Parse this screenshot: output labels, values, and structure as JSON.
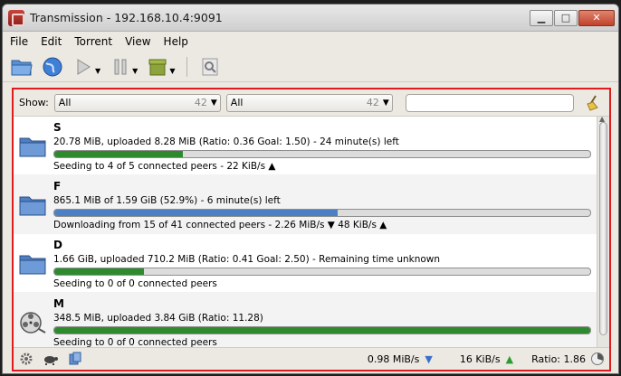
{
  "window": {
    "title": "Transmission - 192.168.10.4:9091"
  },
  "menu": [
    "File",
    "Edit",
    "Torrent",
    "View",
    "Help"
  ],
  "filter": {
    "show_label": "Show:",
    "combo1": {
      "value": "All",
      "count": "42"
    },
    "combo2": {
      "value": "All",
      "count": "42"
    },
    "search_value": ""
  },
  "torrents": [
    {
      "name": "S",
      "progress_text": "20.78 MiB, uploaded 8.28 MiB (Ratio: 0.36 Goal: 1.50) - 24 minute(s) left",
      "status_text": "Seeding to 4 of 5 connected peers - 22 KiB/s ▲",
      "progress": 0.24,
      "bar_color": "#2f8a2f",
      "icon": "folder-icon"
    },
    {
      "name": "F",
      "progress_text": "865.1 MiB of 1.59 GiB (52.9%) - 6 minute(s) left",
      "status_text": "Downloading from 15 of 41 connected peers - 2.26 MiB/s ▼  48 KiB/s ▲",
      "progress": 0.529,
      "bar_color": "#4d7fc4",
      "icon": "folder-icon"
    },
    {
      "name": "D",
      "progress_text": "1.66 GiB, uploaded 710.2 MiB (Ratio: 0.41 Goal: 2.50) - Remaining time unknown",
      "status_text": "Seeding to 0 of 0 connected peers",
      "progress": 0.167,
      "bar_color": "#2f8a2f",
      "icon": "folder-icon"
    },
    {
      "name": "M",
      "progress_text": "348.5 MiB, uploaded 3.84 GiB (Ratio: 11.28)",
      "status_text": "Seeding to 0 of 0 connected peers",
      "progress": 1.0,
      "bar_color": "#2f8a2f",
      "icon": "film-reel-icon"
    }
  ],
  "status": {
    "down_speed": "0.98 MiB/s",
    "up_speed": "16 KiB/s",
    "ratio": "Ratio: 1.86"
  }
}
